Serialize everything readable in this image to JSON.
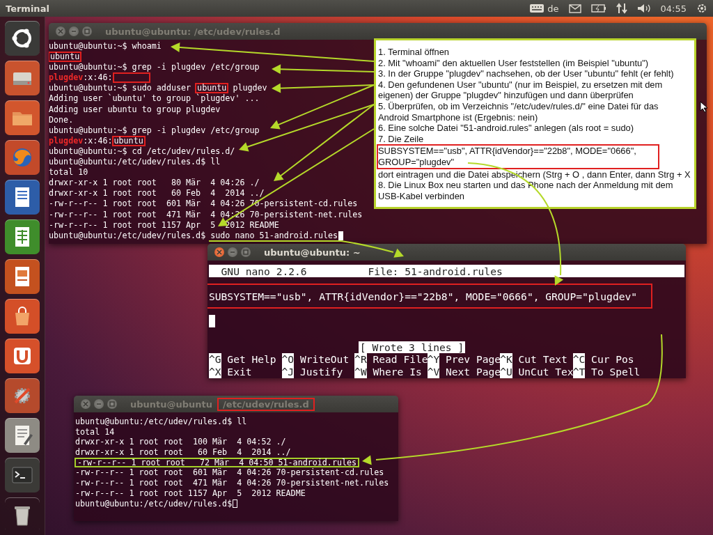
{
  "top_bar": {
    "app_title": "Terminal",
    "keyboard_layout": "de",
    "clock": "04:55"
  },
  "launcher": {
    "items": [
      {
        "kind": "dash"
      },
      {
        "kind": "drive"
      },
      {
        "kind": "folder"
      },
      {
        "kind": "browser"
      },
      {
        "kind": "writer"
      },
      {
        "kind": "calc"
      },
      {
        "kind": "impress"
      },
      {
        "kind": "store"
      },
      {
        "kind": "ubuntu_one"
      },
      {
        "kind": "settings"
      },
      {
        "kind": "editor"
      },
      {
        "kind": "terminal"
      },
      {
        "kind": "trash"
      }
    ]
  },
  "terminal_main": {
    "title": "ubuntu@ubuntu: /etc/udev/rules.d",
    "focused": false,
    "cursor_hollow": false,
    "lines": [
      "ubuntu@ubuntu:~$ whoami",
      {
        "parts": [
          {
            "kind": "box",
            "text": "ubuntu"
          }
        ]
      },
      "ubuntu@ubuntu:~$ grep -i plugdev /etc/group",
      {
        "parts": [
          {
            "kind": "red",
            "text": "plugdev"
          },
          {
            "kind": "plain",
            "text": ":x:46:"
          },
          {
            "kind": "empty_box"
          }
        ]
      },
      {
        "parts": [
          {
            "kind": "plain",
            "text": "ubuntu@ubuntu:~$ sudo adduser "
          },
          {
            "kind": "box",
            "text": "ubuntu"
          },
          {
            "kind": "plain",
            "text": " plugdev"
          }
        ]
      },
      "Adding user `ubuntu' to group `plugdev' ...",
      "Adding user ubuntu to group plugdev",
      "Done.",
      "ubuntu@ubuntu:~$ grep -i plugdev /etc/group",
      {
        "parts": [
          {
            "kind": "red",
            "text": "plugdev"
          },
          {
            "kind": "plain",
            "text": ":x:46:"
          },
          {
            "kind": "box",
            "text": "ubuntu"
          }
        ]
      },
      "ubuntu@ubuntu:~$ cd /etc/udev/rules.d/",
      "ubuntu@ubuntu:/etc/udev/rules.d$ ll",
      "total 10",
      "drwxr-xr-x 1 root root   80 Mär  4 04:26 ./",
      "drwxr-xr-x 1 root root   60 Feb  4  2014 ../",
      "-rw-r--r-- 1 root root  601 Mär  4 04:26 70-persistent-cd.rules",
      "-rw-r--r-- 1 root root  471 Mär  4 04:26 70-persistent-net.rules",
      "-rw-r--r-- 1 root root 1157 Apr  5  2012 README",
      "ubuntu@ubuntu:/etc/udev/rules.d$ sudo nano 51-android.rules"
    ]
  },
  "instructions": [
    {
      "text": "1. Terminal öffnen",
      "boxed": false
    },
    {
      "text": "2. Mit \"whoami\" den aktuellen User feststellen (im Beispiel \"ubuntu\")",
      "boxed": false
    },
    {
      "text": "3. In der Gruppe \"plugdev\" nachsehen, ob der User \"ubuntu\" fehlt (er fehlt)",
      "boxed": false
    },
    {
      "text": "4. Den gefundenen User \"ubuntu\" (nur im Beispiel, zu ersetzen mit dem eigenen) der Gruppe \"plugdev\" hinzufügen und dann überprüfen",
      "boxed": false
    },
    {
      "text": "5. Überprüfen, ob im Verzeichnis \"/etc/udev/rules.d/\" eine Datei für das Android Smartphone ist (Ergebnis: nein)",
      "boxed": false
    },
    {
      "text": "6. Eine solche Datei \"51-android.rules\" anlegen (als root = sudo)",
      "boxed": false
    },
    {
      "text": "7. Die Zeile",
      "boxed": false
    },
    {
      "text": "SUBSYSTEM==\"usb\", ATTR{idVendor}==\"22b8\", MODE=\"0666\", GROUP=\"plugdev\"",
      "boxed": true
    },
    {
      "text": "dort eintragen und die Datei abspeichern (Strg + O , dann Enter, dann Strg + X",
      "boxed": false
    },
    {
      "text": "8. Die Linux Box neu starten und das Phone nach der Anmeldung mit dem USB-Kabel verbinden",
      "boxed": false
    }
  ],
  "nano_window": {
    "title": "ubuntu@ubuntu: ~",
    "focused": true,
    "version": "GNU nano 2.2.6",
    "file": "File: 51-android.rules",
    "content": "SUBSYSTEM==\"usb\", ATTR{idVendor}==\"22b8\", MODE=\"0666\", GROUP=\"plugdev\"",
    "content_boxed": true,
    "cursor_hollow": false,
    "status": "[ Wrote 3 lines ]",
    "shortcuts": [
      {
        "key": "^G",
        "label": "Get Help"
      },
      {
        "key": "^O",
        "label": "WriteOut"
      },
      {
        "key": "^R",
        "label": "Read File"
      },
      {
        "key": "^Y",
        "label": "Prev Page"
      },
      {
        "key": "^K",
        "label": "Cut Text"
      },
      {
        "key": "^C",
        "label": "Cur Pos"
      },
      {
        "key": "^X",
        "label": "Exit"
      },
      {
        "key": "^J",
        "label": "Justify"
      },
      {
        "key": "^W",
        "label": "Where Is"
      },
      {
        "key": "^V",
        "label": "Next Page"
      },
      {
        "key": "^U",
        "label": "UnCut Tex"
      },
      {
        "key": "^T",
        "label": "To Spell"
      }
    ]
  },
  "terminal_bottom": {
    "title": "ubuntu@ubuntu",
    "title_path": "/etc/udev/rules.d",
    "focused": false,
    "cursor_hollow": true,
    "lines": [
      "ubuntu@ubuntu:/etc/udev/rules.d$ ll",
      "total 14",
      "drwxr-xr-x 1 root root  100 Mär  4 04:52 ./",
      "drwxr-xr-x 1 root root   60 Feb  4  2014 ../",
      {
        "parts": [
          {
            "kind": "green_box",
            "text": "-rw-r--r-- 1 root root   72 Mär  4 04:50 51-android.rules"
          }
        ]
      },
      "-rw-r--r-- 1 root root  601 Mär  4 04:26 70-persistent-cd.rules",
      "-rw-r--r-- 1 root root  471 Mär  4 04:26 70-persistent-net.rules",
      "-rw-r--r-- 1 root root 1157 Apr  5  2012 README",
      "ubuntu@ubuntu:/etc/udev/rules.d$"
    ]
  }
}
